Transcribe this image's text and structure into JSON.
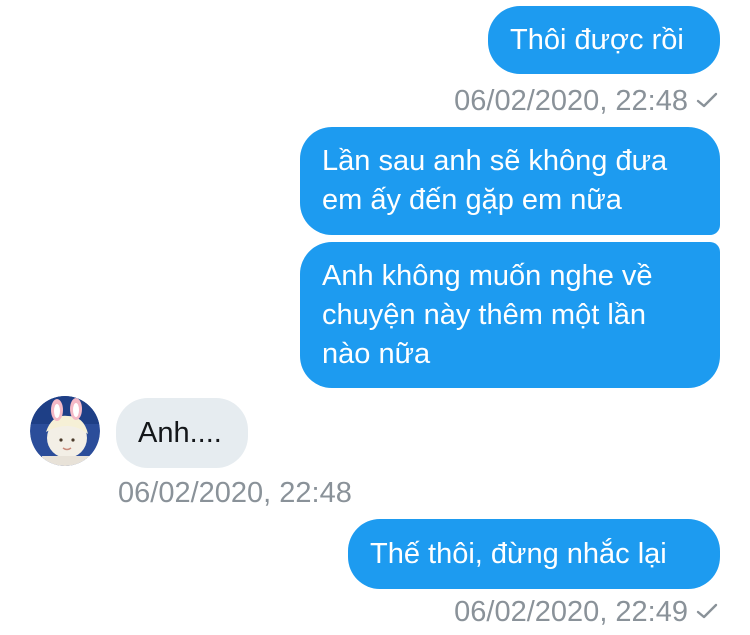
{
  "messages": [
    {
      "direction": "outgoing",
      "text": "Thôi được rồi"
    },
    {
      "direction": "outgoing",
      "text": "Lần sau anh sẽ không đưa em ấy đến gặp em nữa"
    },
    {
      "direction": "outgoing",
      "text": "Anh không muốn nghe về chuyện này thêm một lần nào nữa"
    },
    {
      "direction": "incoming",
      "text": "Anh...."
    },
    {
      "direction": "outgoing",
      "text": "Thế thôi, đừng nhắc lại"
    }
  ],
  "timestamps": [
    {
      "text": "06/02/2020, 22:48",
      "icon": "check-icon"
    },
    {
      "text": "06/02/2020, 22:48"
    },
    {
      "text": "06/02/2020, 22:49",
      "icon": "check-icon"
    }
  ],
  "colors": {
    "outgoing_bubble": "#1d9bf0",
    "incoming_bubble": "#e6ecf0",
    "timestamp": "#8a9299"
  }
}
